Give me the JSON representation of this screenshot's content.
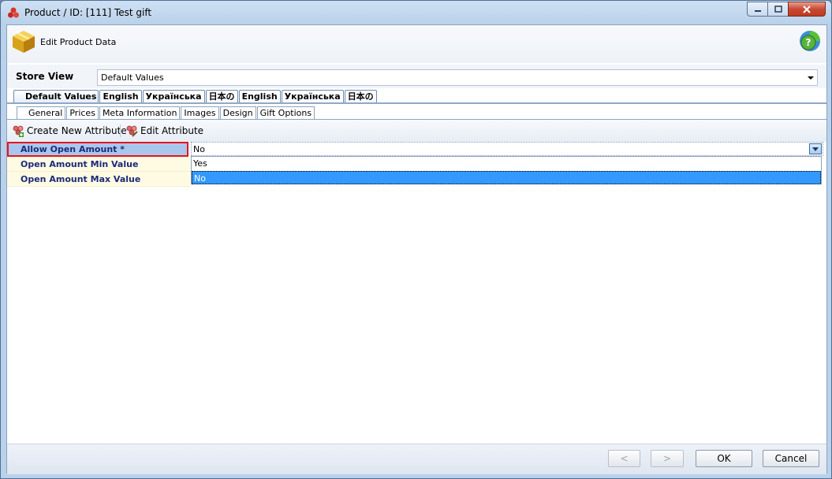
{
  "window": {
    "title": "Product / ID: [111] Test gift"
  },
  "header": {
    "title": "Edit Product Data"
  },
  "store_view": {
    "label": "Store View",
    "value": "Default Values"
  },
  "store_tabs": [
    "Default Values",
    "English",
    "Українська",
    "日本の",
    "English",
    "Українська",
    "日本の"
  ],
  "section_tabs": [
    "General",
    "Prices",
    "Meta Information",
    "Images",
    "Design",
    "Gift Options"
  ],
  "toolbar": {
    "create_label": "Create New Attribute",
    "edit_label": "Edit Attribute"
  },
  "attributes": [
    {
      "name": "Allow Open Amount *",
      "value": "No"
    },
    {
      "name": "Open Amount Min Value",
      "value": ""
    },
    {
      "name": "Open Amount Max Value",
      "value": ""
    }
  ],
  "dropdown": {
    "options": [
      "Yes",
      "No"
    ],
    "selected": "No"
  },
  "footer": {
    "prev_label": "<",
    "next_label": ">",
    "ok_label": "OK",
    "cancel_label": "Cancel"
  }
}
